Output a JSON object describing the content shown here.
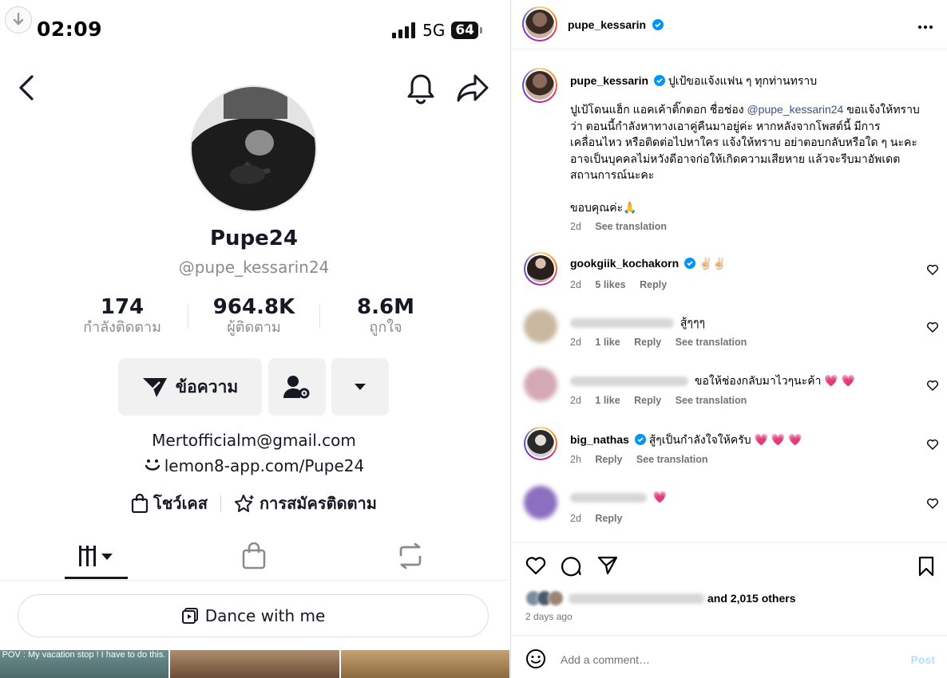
{
  "tiktok": {
    "status": {
      "time": "02:09",
      "network": "5G",
      "battery": "64"
    },
    "profile": {
      "display_name": "Pupe24",
      "handle": "@pupe_kessarin24",
      "stats": [
        {
          "value": "174",
          "label": "กำลังติดตาม"
        },
        {
          "value": "964.8K",
          "label": "ผู้ติดตาม"
        },
        {
          "value": "8.6M",
          "label": "ถูกใจ"
        }
      ],
      "message_button": "ข้อความ",
      "email": "Mertofficialm@gmail.com",
      "link": "lemon8-app.com/Pupe24",
      "showcase": "โชว์เคส",
      "subscribe": "การสมัครติดตาม",
      "playlist": "Dance with me",
      "thumb_caption": "POV : My vacation stop ! I have to do this."
    }
  },
  "instagram": {
    "header_username": "pupe_kessarin",
    "caption": {
      "username": "pupe_kessarin",
      "title": "ปูเป้ขอแจ้งแฟน ๆ ทุกท่านทราบ",
      "body_before": "ปูเป้โดนแฮ็ก แอคเค้าติ๊กตอก ชื่อช่อง ",
      "mention": "@pupe_kessarin24",
      "body_after": " ขอแจ้งให้ทราบว่า ตอนนี้กำลังหาทางเอาคู่คืนมาอยู่ค่ะ หากหลังจากโพสต์นี้ มีการเคลื่อนไหว หรือติดต่อไปหาใคร แจ้งให้ทราบ อย่าตอบกลับหรือใด ๆ นะคะ อาจเป็นบุคคลไม่หวังดีอาจก่อให้เกิดความเสียหาย แล้วจะรีบมาอัพเดตสถานการณ์นะคะ",
      "thanks": "ขอบคุณค่ะ🙏",
      "time": "2d",
      "see_translation": "See translation"
    },
    "comments": [
      {
        "username": "gookgiik_kochakorn",
        "verified": true,
        "text": "✌🏻✌🏻",
        "time": "2d",
        "likes": "5 likes",
        "reply": "Reply",
        "see_translation": ""
      },
      {
        "username": "",
        "verified": false,
        "text": "สู้ๆๆๆ",
        "time": "2d",
        "likes": "1 like",
        "reply": "Reply",
        "see_translation": "See translation"
      },
      {
        "username": "",
        "verified": false,
        "text": "ขอให้ช่องกลับมาไวๆนะค้า 💗 💗",
        "time": "2d",
        "likes": "1 like",
        "reply": "Reply",
        "see_translation": "See translation"
      },
      {
        "username": "big_nathas",
        "verified": true,
        "text": "สู้ๆเป็นกำลังใจให้ครับ 💗 💗 💗",
        "time": "2h",
        "likes": "",
        "reply": "Reply",
        "see_translation": "See translation"
      },
      {
        "username": "",
        "verified": false,
        "text": "💗",
        "time": "2d",
        "likes": "",
        "reply": "Reply",
        "see_translation": ""
      }
    ],
    "likes_text": "and 2,015 others",
    "ago": "2 days ago",
    "add_comment_placeholder": "Add a comment…",
    "post_button": "Post"
  }
}
